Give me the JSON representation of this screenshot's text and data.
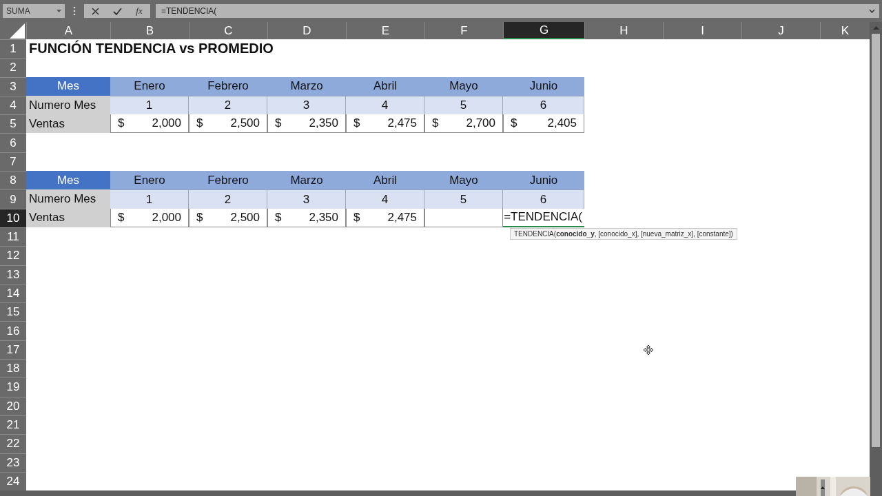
{
  "formula_bar": {
    "name_box": "SUMA",
    "function_label": "fx",
    "formula": "=TENDENCIA("
  },
  "columns": [
    {
      "label": "A",
      "selected": false
    },
    {
      "label": "B",
      "selected": false
    },
    {
      "label": "C",
      "selected": false
    },
    {
      "label": "D",
      "selected": false
    },
    {
      "label": "E",
      "selected": false
    },
    {
      "label": "F",
      "selected": false
    },
    {
      "label": "G",
      "selected": true
    },
    {
      "label": "H",
      "selected": false
    },
    {
      "label": "I",
      "selected": false
    },
    {
      "label": "J",
      "selected": false
    },
    {
      "label": "K",
      "selected": false
    }
  ],
  "rows": [
    {
      "number": "1",
      "selected": false,
      "cells": [
        {
          "kind": "title",
          "text": "FUNCIÓN TENDENCIA vs PROMEDIO"
        }
      ]
    },
    {
      "number": "2",
      "selected": false
    },
    {
      "number": "3",
      "selected": false,
      "cells": [
        {
          "kind": "header-label",
          "text": "Mes"
        },
        {
          "kind": "header",
          "text": "Enero"
        },
        {
          "kind": "header",
          "text": "Febrero"
        },
        {
          "kind": "header",
          "text": "Marzo"
        },
        {
          "kind": "header",
          "text": "Abril"
        },
        {
          "kind": "header",
          "text": "Mayo"
        },
        {
          "kind": "header",
          "text": "Junio"
        }
      ]
    },
    {
      "number": "4",
      "selected": false,
      "cells": [
        {
          "kind": "label",
          "text": "Numero Mes"
        },
        {
          "kind": "number",
          "text": "1"
        },
        {
          "kind": "number",
          "text": "2"
        },
        {
          "kind": "number",
          "text": "3"
        },
        {
          "kind": "number",
          "text": "4"
        },
        {
          "kind": "number",
          "text": "5"
        },
        {
          "kind": "number",
          "text": "6"
        }
      ]
    },
    {
      "number": "5",
      "selected": false,
      "cells": [
        {
          "kind": "label",
          "text": "Ventas"
        },
        {
          "kind": "currency",
          "symbol": "$",
          "amount": "2,000"
        },
        {
          "kind": "currency",
          "symbol": "$",
          "amount": "2,500"
        },
        {
          "kind": "currency",
          "symbol": "$",
          "amount": "2,350"
        },
        {
          "kind": "currency",
          "symbol": "$",
          "amount": "2,475"
        },
        {
          "kind": "currency",
          "symbol": "$",
          "amount": "2,700"
        },
        {
          "kind": "currency",
          "symbol": "$",
          "amount": "2,405"
        }
      ]
    },
    {
      "number": "6",
      "selected": false
    },
    {
      "number": "7",
      "selected": false
    },
    {
      "number": "8",
      "selected": false,
      "cells": [
        {
          "kind": "header-label",
          "text": "Mes"
        },
        {
          "kind": "header",
          "text": "Enero"
        },
        {
          "kind": "header",
          "text": "Febrero"
        },
        {
          "kind": "header",
          "text": "Marzo"
        },
        {
          "kind": "header",
          "text": "Abril"
        },
        {
          "kind": "header",
          "text": "Mayo"
        },
        {
          "kind": "header",
          "text": "Junio"
        }
      ]
    },
    {
      "number": "9",
      "selected": false,
      "cells": [
        {
          "kind": "label",
          "text": "Numero Mes"
        },
        {
          "kind": "number",
          "text": "1"
        },
        {
          "kind": "number",
          "text": "2"
        },
        {
          "kind": "number",
          "text": "3"
        },
        {
          "kind": "number",
          "text": "4"
        },
        {
          "kind": "number",
          "text": "5"
        },
        {
          "kind": "number",
          "text": "6"
        }
      ]
    },
    {
      "number": "10",
      "selected": true,
      "cells": [
        {
          "kind": "label",
          "text": "Ventas"
        },
        {
          "kind": "currency",
          "symbol": "$",
          "amount": "2,000"
        },
        {
          "kind": "currency",
          "symbol": "$",
          "amount": "2,500"
        },
        {
          "kind": "currency",
          "symbol": "$",
          "amount": "2,350"
        },
        {
          "kind": "currency",
          "symbol": "$",
          "amount": "2,475"
        },
        {
          "kind": "blank"
        },
        {
          "kind": "editing",
          "text": "=TENDENCIA(",
          "tooltip": "TENDENCIA(**conocido_y**, [conocido_x], [nueva_matriz_x], [constante])"
        }
      ]
    },
    {
      "number": "11",
      "selected": false
    },
    {
      "number": "12",
      "selected": false
    },
    {
      "number": "13",
      "selected": false
    },
    {
      "number": "14",
      "selected": false
    },
    {
      "number": "15",
      "selected": false
    },
    {
      "number": "16",
      "selected": false
    },
    {
      "number": "17",
      "selected": false
    },
    {
      "number": "18",
      "selected": false
    },
    {
      "number": "19",
      "selected": false
    },
    {
      "number": "20",
      "selected": false
    },
    {
      "number": "21",
      "selected": false
    },
    {
      "number": "22",
      "selected": false
    },
    {
      "number": "23",
      "selected": false
    },
    {
      "number": "24",
      "selected": false
    }
  ]
}
